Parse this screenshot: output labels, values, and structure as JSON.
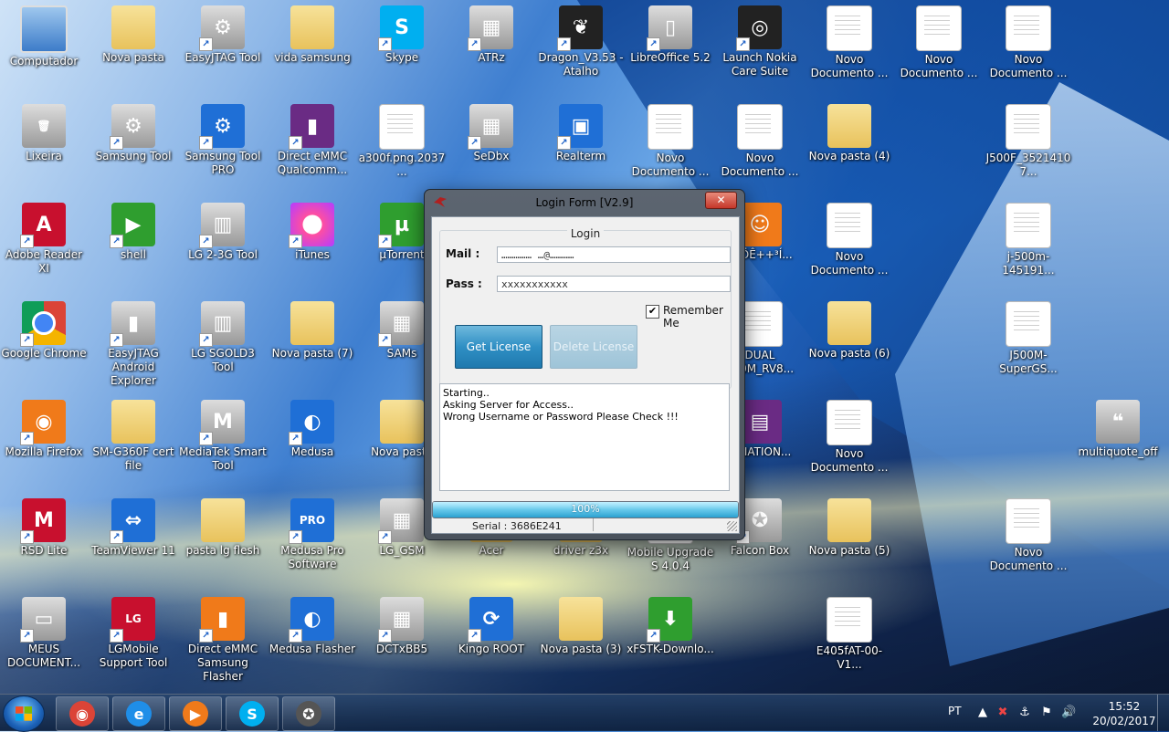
{
  "desktop": {
    "icons": [
      {
        "label": "Computador",
        "glyph": "",
        "style": "g-pc",
        "shortcut": false
      },
      {
        "label": "Nova pasta",
        "glyph": "",
        "style": "g-folder",
        "shortcut": false
      },
      {
        "label": "EasyJTAG Tool",
        "glyph": "⚙",
        "style": "g-gray",
        "shortcut": true
      },
      {
        "label": "vida samsung",
        "glyph": "",
        "style": "g-folder",
        "shortcut": false
      },
      {
        "label": "Skype",
        "glyph": "S",
        "style": "g-skype",
        "shortcut": true
      },
      {
        "label": "ATRz",
        "glyph": "▦",
        "style": "g-gray",
        "shortcut": true
      },
      {
        "label": "Dragon_V3.53 - Atalho",
        "glyph": "❦",
        "style": "g-dark",
        "shortcut": true
      },
      {
        "label": "LibreOffice 5.2",
        "glyph": "▯",
        "style": "g-gray",
        "shortcut": true
      },
      {
        "label": "Launch Nokia Care Suite",
        "glyph": "◎",
        "style": "g-dark",
        "shortcut": true
      },
      {
        "label": "Novo Documento ...",
        "glyph": "",
        "style": "g-doc",
        "shortcut": false
      },
      {
        "label": "Novo Documento ...",
        "glyph": "",
        "style": "g-doc",
        "shortcut": false
      },
      {
        "label": "Novo Documento ...",
        "glyph": "",
        "style": "g-doc",
        "shortcut": false
      },
      {
        "label": "Lixeira",
        "glyph": "🗑",
        "style": "g-gray",
        "shortcut": false
      },
      {
        "label": "Samsung Tool",
        "glyph": "⚙",
        "style": "g-gray",
        "shortcut": true
      },
      {
        "label": "Samsung Tool PRO",
        "glyph": "⚙",
        "style": "g-blue",
        "shortcut": true
      },
      {
        "label": "Direct eMMC Qualcomm...",
        "glyph": "▮",
        "style": "g-purple",
        "shortcut": true
      },
      {
        "label": "a300f.png.2037...",
        "glyph": "▤",
        "style": "g-doc",
        "shortcut": false
      },
      {
        "label": "SeDbx",
        "glyph": "▦",
        "style": "g-gray",
        "shortcut": true
      },
      {
        "label": "Realterm",
        "glyph": "▣",
        "style": "g-blue",
        "shortcut": true
      },
      {
        "label": "Novo Documento ...",
        "glyph": "",
        "style": "g-doc",
        "shortcut": false
      },
      {
        "label": "Novo Documento ...",
        "glyph": "",
        "style": "g-doc",
        "shortcut": false
      },
      {
        "label": "Nova pasta (4)",
        "glyph": "",
        "style": "g-folder",
        "shortcut": false
      },
      {
        "label": "J500F_35214107...",
        "glyph": "",
        "style": "g-doc",
        "shortcut": false
      },
      {
        "label": "Adobe Reader XI",
        "glyph": "A",
        "style": "g-red",
        "shortcut": true
      },
      {
        "label": "shell",
        "glyph": "▶",
        "style": "g-green",
        "shortcut": true
      },
      {
        "label": "LG 2-3G Tool",
        "glyph": "▥",
        "style": "g-gray",
        "shortcut": true
      },
      {
        "label": "iTunes",
        "glyph": "♪",
        "style": "g-itunes",
        "shortcut": true
      },
      {
        "label": "µTorrent",
        "glyph": "µ",
        "style": "g-green",
        "shortcut": true
      },
      {
        "label": "Ö-ÖÊ++³Í...",
        "glyph": "☺",
        "style": "g-orange",
        "shortcut": false
      },
      {
        "label": "Novo Documento ...",
        "glyph": "",
        "style": "g-doc",
        "shortcut": false
      },
      {
        "label": "j-500m-145191...",
        "glyph": "",
        "style": "g-doc",
        "shortcut": false
      },
      {
        "label": "Google Chrome",
        "glyph": "",
        "style": "g-chrome",
        "shortcut": true
      },
      {
        "label": "EasyJTAG Android Explorer",
        "glyph": "▮",
        "style": "g-gray",
        "shortcut": true
      },
      {
        "label": "LG SGOLD3 Tool",
        "glyph": "▥",
        "style": "g-gray",
        "shortcut": true
      },
      {
        "label": "Nova pasta (7)",
        "glyph": "",
        "style": "g-folder",
        "shortcut": false
      },
      {
        "label": "SAMs",
        "glyph": "▦",
        "style": "g-gray",
        "shortcut": true
      },
      {
        "label": "DUAL 500M_RV8...",
        "glyph": "",
        "style": "g-doc",
        "shortcut": false
      },
      {
        "label": "Nova pasta (6)",
        "glyph": "",
        "style": "g-folder",
        "shortcut": false
      },
      {
        "label": "J500M-SuperGS...",
        "glyph": "",
        "style": "g-doc",
        "shortcut": false
      },
      {
        "label": "Mozilla Firefox",
        "glyph": "◉",
        "style": "g-orange",
        "shortcut": true
      },
      {
        "label": "SM-G360F cert file",
        "glyph": "",
        "style": "g-folder",
        "shortcut": false
      },
      {
        "label": "MediaTek Smart Tool",
        "glyph": "M",
        "style": "g-gray",
        "shortcut": true
      },
      {
        "label": "Medusa",
        "glyph": "◐",
        "style": "g-blue",
        "shortcut": true
      },
      {
        "label": "Nova pasta",
        "glyph": "",
        "style": "g-folder",
        "shortcut": false
      },
      {
        "label": "BINATION...",
        "glyph": "▤",
        "style": "g-purple",
        "shortcut": false
      },
      {
        "label": "Novo Documento ...",
        "glyph": "",
        "style": "g-doc",
        "shortcut": false
      },
      {
        "label": "multiquote_off",
        "glyph": "❝",
        "style": "g-gray",
        "shortcut": false
      },
      {
        "label": "RSD Lite",
        "glyph": "M",
        "style": "g-red",
        "shortcut": true
      },
      {
        "label": "TeamViewer 11",
        "glyph": "⇔",
        "style": "g-blue",
        "shortcut": true
      },
      {
        "label": "pasta lg flesh",
        "glyph": "",
        "style": "g-folder",
        "shortcut": false
      },
      {
        "label": "Medusa Pro Software",
        "glyph": "PRO",
        "style": "g-blue",
        "shortcut": true
      },
      {
        "label": "LG_GSM",
        "glyph": "▦",
        "style": "g-gray",
        "shortcut": true
      },
      {
        "label": "Acer",
        "glyph": "",
        "style": "g-folder",
        "shortcut": false
      },
      {
        "label": "driver z3x",
        "glyph": "",
        "style": "g-folder",
        "shortcut": false
      },
      {
        "label": "Mobile Upgrade S 4.0.4",
        "glyph": "",
        "style": "g-doc",
        "shortcut": false
      },
      {
        "label": "Falcon Box",
        "glyph": "✪",
        "style": "g-gray",
        "shortcut": true
      },
      {
        "label": "Nova pasta (5)",
        "glyph": "",
        "style": "g-folder",
        "shortcut": false
      },
      {
        "label": "Novo Documento ...",
        "glyph": "",
        "style": "g-doc",
        "shortcut": false
      },
      {
        "label": "MEUS DOCUMENT...",
        "glyph": "▭",
        "style": "g-gray",
        "shortcut": true
      },
      {
        "label": "LGMobile Support Tool",
        "glyph": "LG",
        "style": "g-red",
        "shortcut": true
      },
      {
        "label": "Direct eMMC Samsung Flasher",
        "glyph": "▮",
        "style": "g-orange",
        "shortcut": true
      },
      {
        "label": "Medusa Flasher",
        "glyph": "◐",
        "style": "g-blue",
        "shortcut": true
      },
      {
        "label": "DCTxBB5",
        "glyph": "▦",
        "style": "g-gray",
        "shortcut": true
      },
      {
        "label": "Kingo ROOT",
        "glyph": "⟳",
        "style": "g-blue",
        "shortcut": true
      },
      {
        "label": "Nova pasta (3)",
        "glyph": "",
        "style": "g-folder",
        "shortcut": false
      },
      {
        "label": "xFSTK-Downlo...",
        "glyph": "⬇",
        "style": "g-green",
        "shortcut": true
      },
      {
        "label": "E405fAT-00-V1...",
        "glyph": "",
        "style": "g-doc",
        "shortcut": false
      }
    ]
  },
  "login_window": {
    "title": "Login Form [V2.9]",
    "close_label": "✕",
    "group_title": "Login",
    "mail_label": "Mail :",
    "mail_value": "……………  …@…………",
    "pass_label": "Pass :",
    "pass_value": "xxxxxxxxxxx",
    "remember_label": "Remember Me",
    "remember_checked": true,
    "get_license_label": "Get License",
    "delete_license_label": "Delete License",
    "log_text": "Starting..\nAsking Server for Access..\nWrong Username or Password Please Check !!!",
    "progress_percent": 100,
    "progress_text": "100%",
    "serial_text": "Serial : 3686E241"
  },
  "taskbar": {
    "apps": [
      {
        "name": "chrome",
        "glyph": "◉",
        "color": "#db4437"
      },
      {
        "name": "internet-explorer",
        "glyph": "e",
        "color": "#1f8ee8"
      },
      {
        "name": "media-player",
        "glyph": "▶",
        "color": "#f07a1a"
      },
      {
        "name": "skype",
        "glyph": "S",
        "color": "#00aff0"
      },
      {
        "name": "falcon-box",
        "glyph": "✪",
        "color": "#555555"
      }
    ],
    "language": "PT",
    "time": "15:52",
    "date": "20/02/2017"
  }
}
